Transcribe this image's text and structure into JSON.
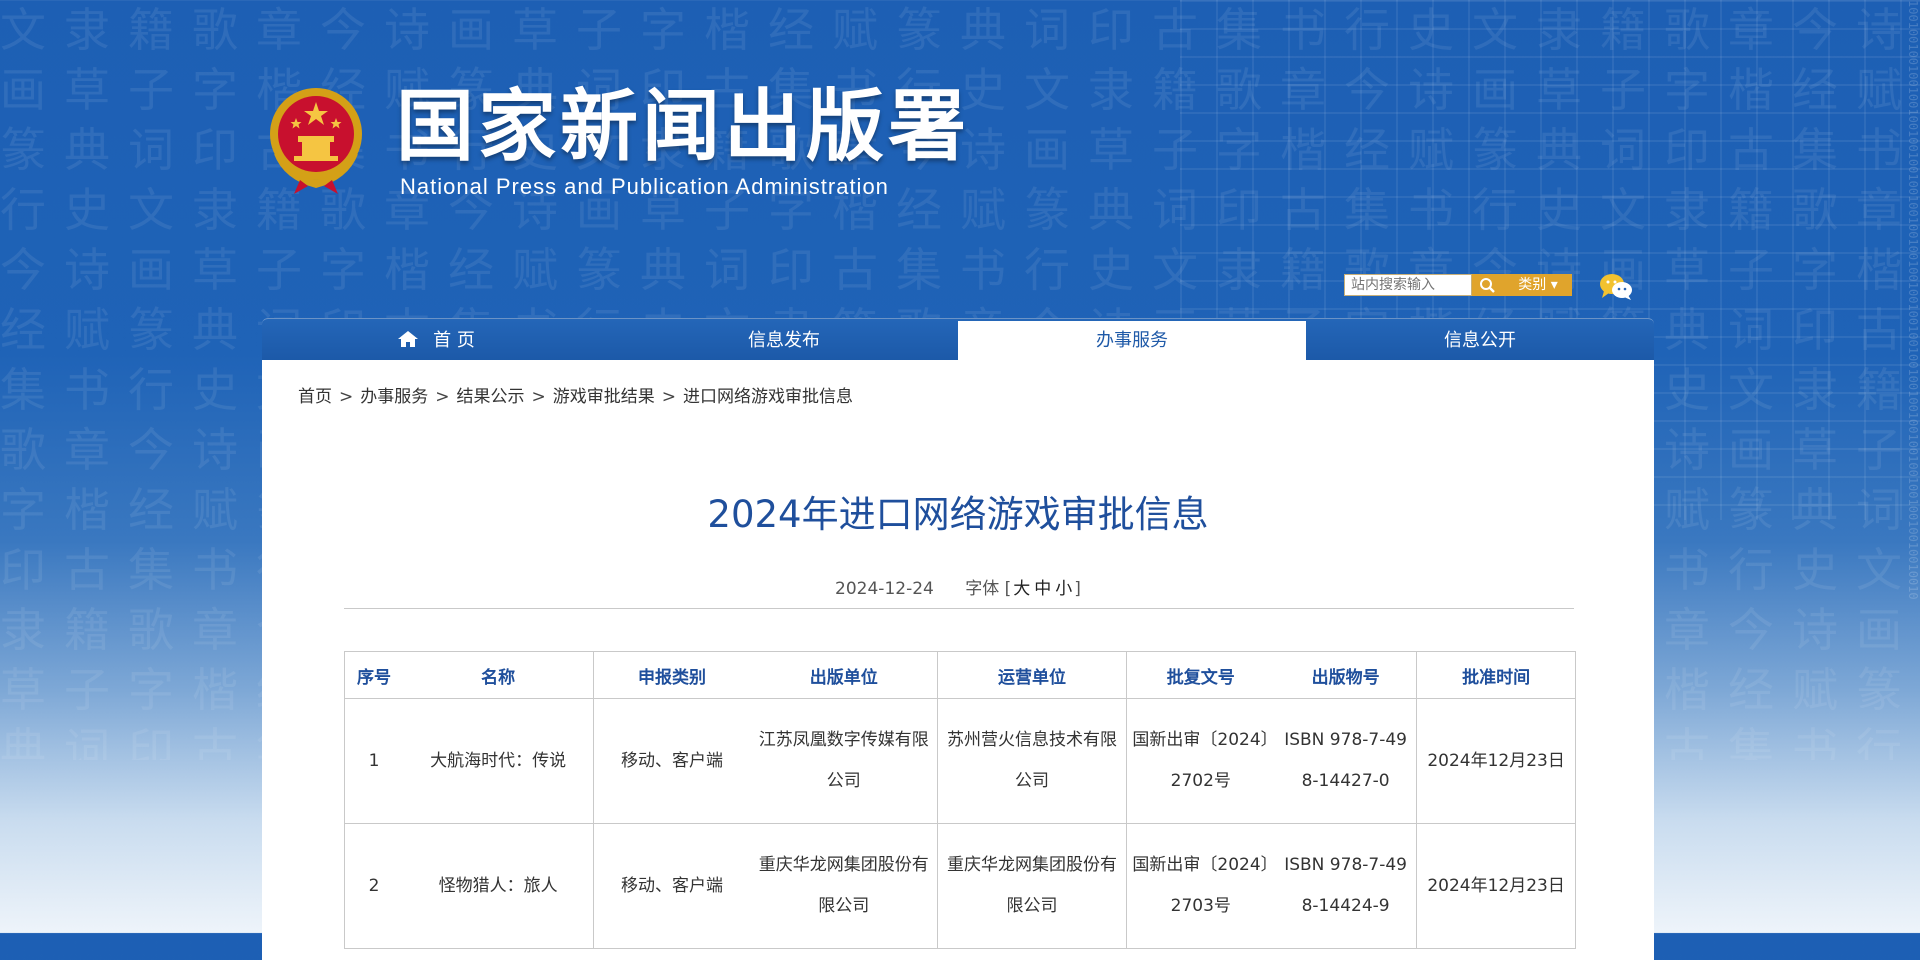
{
  "header": {
    "site_title": "国家新闻出版署",
    "site_subtitle": "National  Press and Publication Administration"
  },
  "search": {
    "placeholder": "站内搜索输入",
    "category_label": "类别 ▾"
  },
  "nav": {
    "items": [
      {
        "label": "首 页",
        "active": false
      },
      {
        "label": "信息发布",
        "active": false
      },
      {
        "label": "办事服务",
        "active": true
      },
      {
        "label": "信息公开",
        "active": false
      }
    ]
  },
  "breadcrumb": [
    "首页",
    "办事服务",
    "结果公示",
    "游戏审批结果",
    "进口网络游戏审批信息"
  ],
  "breadcrumb_separator": ">",
  "article": {
    "title": "2024年进口网络游戏审批信息",
    "date": "2024-12-24",
    "font_label": "字体",
    "font_open": "[",
    "font_close": "]",
    "font_options": [
      "大",
      "中",
      "小"
    ]
  },
  "table": {
    "headers": [
      "序号",
      "名称",
      "申报类别",
      "出版单位",
      "运营单位",
      "批复文号",
      "出版物号",
      "批准时间"
    ],
    "rows": [
      [
        "1",
        "大航海时代：传说",
        "移动、客户端",
        "江苏凤凰数字传媒有限公司",
        "苏州营火信息技术有限公司",
        "国新出审〔2024〕2702号",
        "ISBN 978-7-498-14427-0",
        "2024年12月23日"
      ],
      [
        "2",
        "怪物猎人：旅人",
        "移动、客户端",
        "重庆华龙网集团股份有限公司",
        "重庆华龙网集团股份有限公司",
        "国新出审〔2024〕2703号",
        "ISBN 978-7-498-14424-9",
        "2024年12月23日"
      ]
    ]
  },
  "colors": {
    "brand_blue": "#1f4f9c",
    "nav_blue": "#1c59a8",
    "accent_gold": "#e0a42c"
  },
  "icons": {
    "emblem": "national-emblem-icon",
    "search": "search-icon",
    "wechat": "wechat-icon",
    "home": "home-icon"
  }
}
